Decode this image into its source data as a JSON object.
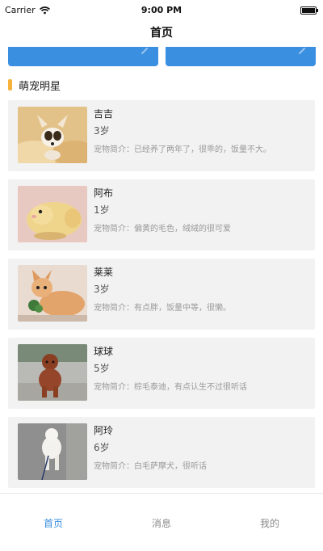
{
  "status_bar": {
    "carrier": "Carrier",
    "time": "9:00 PM"
  },
  "nav": {
    "title": "首页"
  },
  "section": {
    "title": "萌宠明星"
  },
  "pets": [
    {
      "name": "吉吉",
      "age": "3岁",
      "desc": "宠物简介：已经养了两年了，很乖的，饭量不大。"
    },
    {
      "name": "阿布",
      "age": "1岁",
      "desc": "宠物简介：偏黄的毛色，绒绒的很可爱"
    },
    {
      "name": "莱莱",
      "age": "3岁",
      "desc": "宠物简介：有点胖，饭量中等，很懒。"
    },
    {
      "name": "球球",
      "age": "5岁",
      "desc": "宠物简介：棕毛泰迪，有点认生不过很听话"
    },
    {
      "name": "阿玲",
      "age": "6岁",
      "desc": "宠物简介：白毛萨摩犬，很听话"
    }
  ],
  "tabs": {
    "home": "首页",
    "messages": "消息",
    "mine": "我的"
  },
  "colors": {
    "accent": "#3b8fe0",
    "section_mark": "#f5b33c",
    "card_bg": "#f2f2f2"
  }
}
